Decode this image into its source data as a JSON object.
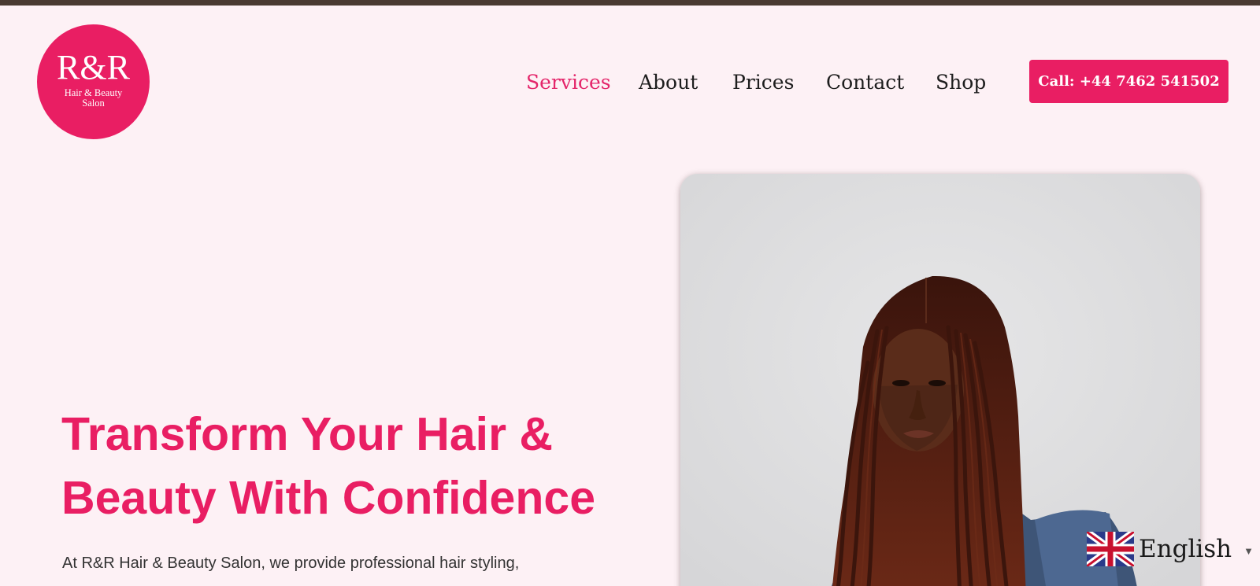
{
  "brand": {
    "logo_main": "R&R",
    "logo_sub": "Hair & Beauty Salon",
    "color": "#e91e63"
  },
  "nav": {
    "items": [
      {
        "label": "Services",
        "active": true
      },
      {
        "label": "About",
        "active": false
      },
      {
        "label": "Prices",
        "active": false
      },
      {
        "label": "Contact",
        "active": false
      },
      {
        "label": "Shop",
        "active": false
      }
    ],
    "call_label": "Call: +44 7462 541502"
  },
  "hero": {
    "headline_line1": "Transform Your Hair &",
    "headline_line2": "Beauty With Confidence",
    "intro": "At R&R Hair & Beauty Salon, we provide professional hair styling,",
    "image": "woman-with-long-box-braids-denim-jacket"
  },
  "language": {
    "label": "English",
    "flag_icon": "uk-flag-icon",
    "caret_icon": "caret-down-icon"
  }
}
